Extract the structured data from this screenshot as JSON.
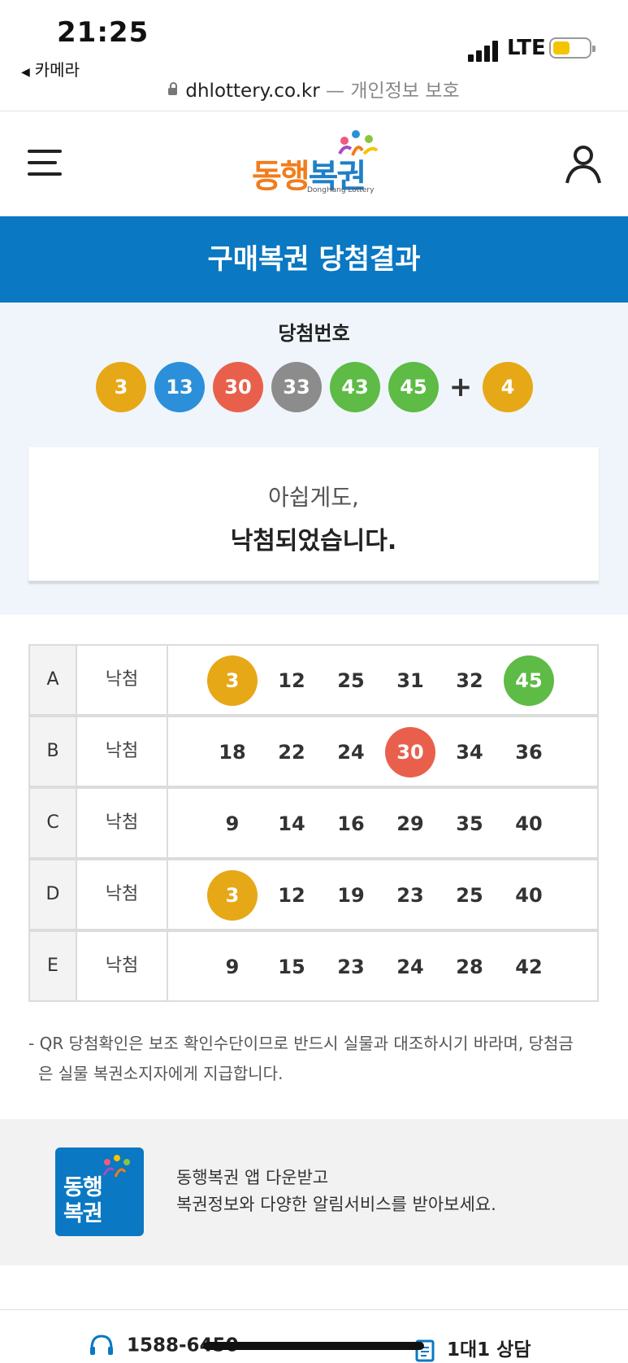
{
  "status_bar": {
    "time": "21:25",
    "back_app": "카메라",
    "network": "LTE"
  },
  "url_bar": {
    "domain": "dhlottery.co.kr",
    "suffix": "— 개인정보 보호"
  },
  "header": {
    "logo_text_a": "동행",
    "logo_text_b": "복권",
    "logo_sub": "DongHang Lottery",
    "menu_icon": "hamburger-icon",
    "user_icon": "user-icon"
  },
  "page_title": "구매복권 당첨결과",
  "winning": {
    "label": "당첨번호",
    "numbers": [
      "3",
      "13",
      "30",
      "33",
      "43",
      "45"
    ],
    "plus": "+",
    "bonus": "4",
    "colors": [
      "#e6a817",
      "#2b90d9",
      "#e8604c",
      "#8c8c8c",
      "#5dbb46",
      "#5dbb46"
    ],
    "bonus_color": "#e6a817"
  },
  "result": {
    "line1": "아쉽게도,",
    "line2": "낙첨되었습니다."
  },
  "games": [
    {
      "game": "A",
      "result": "낙첨",
      "numbers": [
        "3",
        "12",
        "25",
        "31",
        "32",
        "45"
      ]
    },
    {
      "game": "B",
      "result": "낙첨",
      "numbers": [
        "18",
        "22",
        "24",
        "30",
        "34",
        "36"
      ]
    },
    {
      "game": "C",
      "result": "낙첨",
      "numbers": [
        "9",
        "14",
        "16",
        "29",
        "35",
        "40"
      ]
    },
    {
      "game": "D",
      "result": "낙첨",
      "numbers": [
        "3",
        "12",
        "19",
        "23",
        "25",
        "40"
      ]
    },
    {
      "game": "E",
      "result": "낙첨",
      "numbers": [
        "9",
        "15",
        "23",
        "24",
        "28",
        "42"
      ]
    }
  ],
  "notice": {
    "line1": "- QR 당첨확인은 보조 확인수단이므로 반드시 실물과 대조하시기 바라며, 당첨금",
    "line2": "은 실물 복권소지자에게 지급합니다."
  },
  "app_banner": {
    "logo_line1": "동행",
    "logo_line2": "복권",
    "text_line1": "동행복권 앱 다운받고",
    "text_line2": "복권정보와 다양한 알림서비스를 받아보세요."
  },
  "footer": {
    "phone": "1588-6450",
    "chat": "1대1 상담"
  }
}
